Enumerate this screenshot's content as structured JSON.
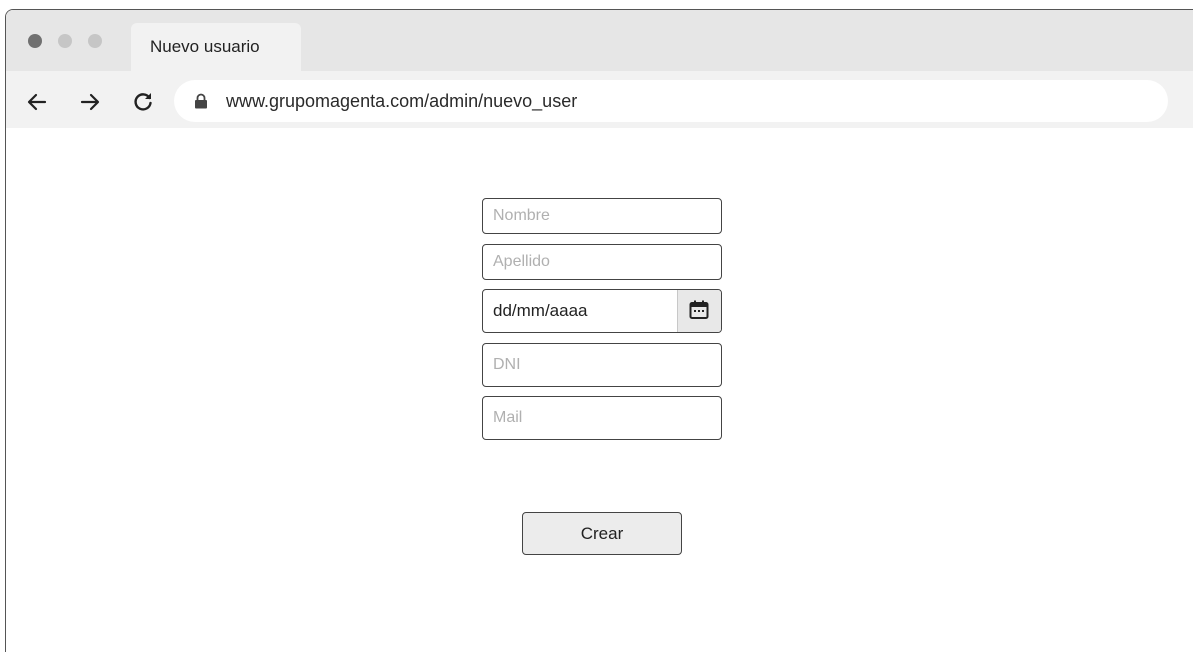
{
  "browser": {
    "tab_title": "Nuevo usuario",
    "url": "www.grupomagenta.com/admin/nuevo_user",
    "icons": [
      "back-arrow-icon",
      "forward-arrow-icon",
      "reload-icon",
      "lock-icon"
    ]
  },
  "form": {
    "nombre_placeholder": "Nombre",
    "apellido_placeholder": "Apellido",
    "date_value": "dd/mm/aaaa",
    "date_icon": "calendar-icon",
    "dni_placeholder": "DNI",
    "mail_placeholder": "Mail",
    "submit_label": "Crear"
  }
}
